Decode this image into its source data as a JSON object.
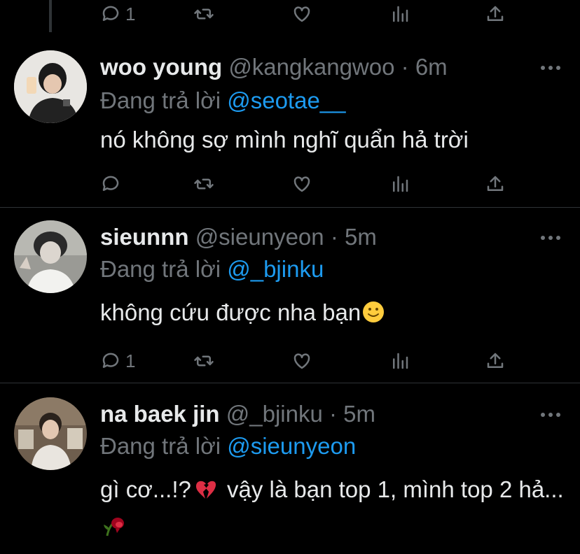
{
  "top_actions": {
    "reply_count": "1"
  },
  "tweets": [
    {
      "name": "woo young",
      "handle": "@kangkangwoo",
      "dot": "·",
      "time": "6m",
      "reply_prefix": "Đang trả lời ",
      "reply_to": "@seotae__",
      "text": "nó không sợ mình nghĩ quẩn hả trời",
      "reply_count": ""
    },
    {
      "name": "sieunnn",
      "handle": "@sieunyeon",
      "dot": "·",
      "time": "5m",
      "reply_prefix": "Đang trả lời ",
      "reply_to": "@_bjinku",
      "text": "không cứu được nha bạn",
      "emoji": "slightly-smiling-face",
      "reply_count": "1"
    },
    {
      "name": "na baek jin",
      "handle": "@_bjinku",
      "dot": "·",
      "time": "5m",
      "reply_prefix": "Đang trả lời ",
      "reply_to": "@sieunyeon",
      "text_part1": "gì cơ...!?",
      "emoji1": "broken-heart",
      "text_part2": " vậy là bạn top 1, mình top 2 hả...",
      "emoji2": "wilted-flower"
    }
  ],
  "colors": {
    "background": "#000000",
    "primary_text": "#e7e9ea",
    "secondary_text": "#71767b",
    "accent": "#1d9bf0",
    "divider": "#2f3336"
  }
}
